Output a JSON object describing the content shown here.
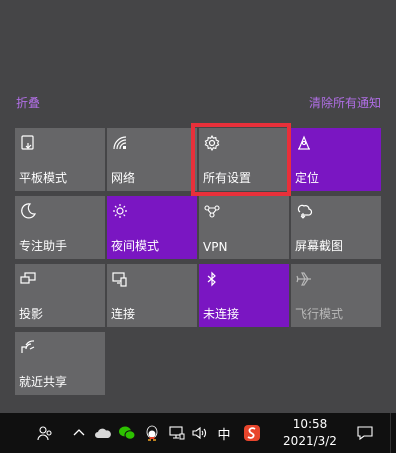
{
  "top_links": {
    "collapse": "折叠",
    "clear_all": "清除所有通知"
  },
  "tiles": [
    {
      "label": "平板模式",
      "icon": "tablet-mode-icon",
      "state": "off"
    },
    {
      "label": "网络",
      "icon": "network-icon",
      "state": "off"
    },
    {
      "label": "所有设置",
      "icon": "gear-icon",
      "state": "off",
      "highlighted": true
    },
    {
      "label": "定位",
      "icon": "location-icon",
      "state": "on"
    },
    {
      "label": "专注助手",
      "icon": "moon-icon",
      "state": "off"
    },
    {
      "label": "夜间模式",
      "icon": "brightness-icon",
      "state": "on"
    },
    {
      "label": "VPN",
      "icon": "vpn-icon",
      "state": "off"
    },
    {
      "label": "屏幕截图",
      "icon": "screenshot-icon",
      "state": "off"
    },
    {
      "label": "投影",
      "icon": "project-icon",
      "state": "off"
    },
    {
      "label": "连接",
      "icon": "connect-icon",
      "state": "off"
    },
    {
      "label": "未连接",
      "icon": "bluetooth-icon",
      "state": "on"
    },
    {
      "label": "飞行模式",
      "icon": "airplane-icon",
      "state": "disabled"
    },
    {
      "label": "就近共享",
      "icon": "nearby-share-icon",
      "state": "off"
    }
  ],
  "taskbar": {
    "clock_time": "10:58",
    "clock_date": "2021/3/2",
    "ime_label": "中",
    "tray_icons": [
      "people-icon",
      "chevron-up-icon",
      "onedrive-cloud-icon",
      "wechat-icon",
      "qq-icon",
      "network-tray-icon",
      "volume-icon"
    ],
    "accent_colors": {
      "tile_on": "#7a16c2",
      "tile_off": "#666668",
      "link": "#b16fe6",
      "highlight_box": "#e8303a",
      "sogou": "#e8452c"
    }
  }
}
